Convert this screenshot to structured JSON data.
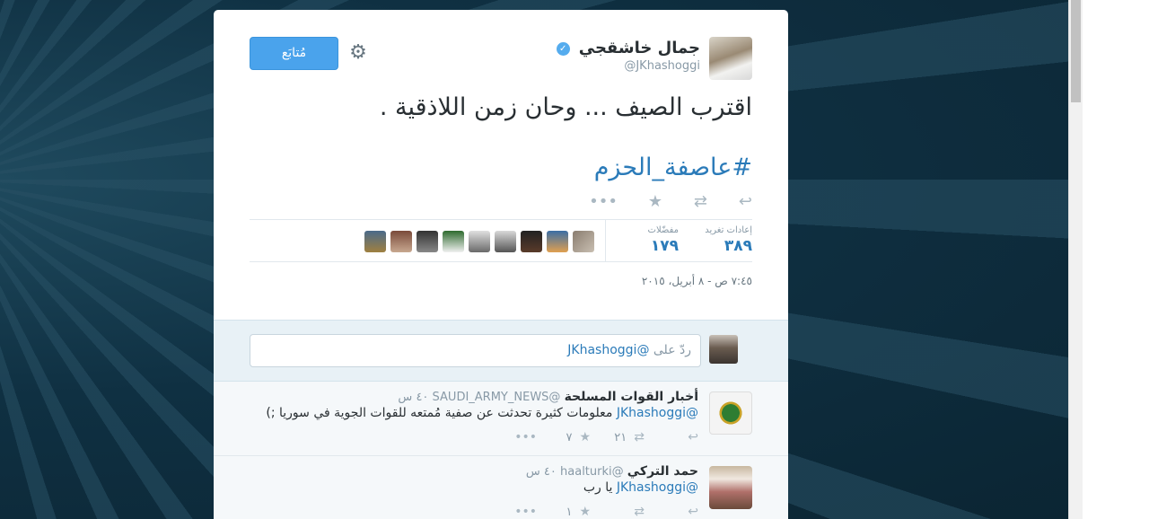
{
  "tweet": {
    "author_name": "جمال خاشقجي",
    "handle": "@JKhashoggi",
    "follow_label": "مُتابَع",
    "text": "اقترب الصيف ... وحان زمن اللاذقية .",
    "hashtag": "#عاصفة_الحزم",
    "actions": {
      "reply": "↩",
      "retweet": "⇄",
      "favorite": "★",
      "more": "•••"
    },
    "stats": {
      "retweets_label": "إعادات تغريد",
      "retweets_value": "٣٨٩",
      "favorites_label": "مفضّلات",
      "favorites_value": "١٧٩"
    },
    "timestamp": "٧:٤٥ ص - ٨ أبريل، ٢٠١٥"
  },
  "reply_box": {
    "prefix": "ردّ على ",
    "mention": "@JKhashoggi"
  },
  "replies": [
    {
      "name": "أخبار القوات المسلحة",
      "handle": "@SAUDI_ARMY_NEWS",
      "time": "٤٠ س",
      "mention": "@JKhashoggi",
      "text": " معلومات كثيرة تحدثت عن صفية مُمتعه للقوات الجوية في سوريا ;)",
      "retweets": "٢١",
      "favorites": "٧"
    },
    {
      "name": "حمد التركي",
      "handle": "@haalturki",
      "time": "٤٠ س",
      "mention": "@JKhashoggi",
      "text": " يا رب",
      "retweets": "",
      "favorites": "١"
    }
  ],
  "colors": {
    "accent": "#2b7bb9",
    "follow_button": "#4aa3ec",
    "background": "#0d2a39"
  }
}
